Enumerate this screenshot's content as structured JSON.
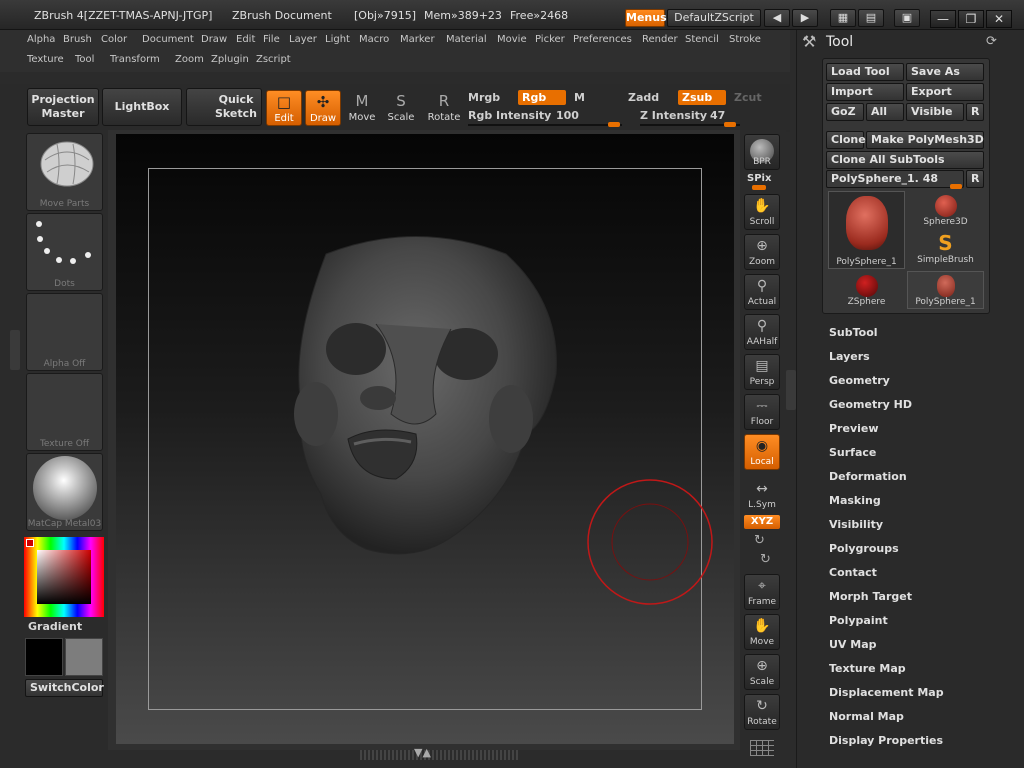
{
  "titlebar": {
    "app_title": "ZBrush 4[ZZET-TMAS-APNJ-JTGP]",
    "document": "ZBrush Document",
    "obj": "[Obj»7915]",
    "mem": "Mem»389+23",
    "free": "Free»2468",
    "menus_label": "Menus",
    "zscript_label": "DefaultZScript"
  },
  "menubar": {
    "row1": [
      "Alpha",
      "Brush",
      "Color",
      "Document",
      "Draw",
      "Edit",
      "File",
      "Layer",
      "Light",
      "Macro",
      "Marker",
      "Material",
      "Movie",
      "Picker",
      "Preferences",
      "Render",
      "Stencil",
      "Stroke"
    ],
    "row2": [
      "Texture",
      "Tool",
      "Transform",
      "Zoom",
      "Zplugin",
      "Zscript"
    ]
  },
  "shelf": {
    "projection_master": "Projection\nMaster",
    "lightbox": "LightBox",
    "quick_sketch": "Quick\nSketch",
    "edit": "Edit",
    "draw": "Draw",
    "move": "Move",
    "scale": "Scale",
    "rotate": "Rotate",
    "mrgb": "Mrgb",
    "rgb": "Rgb",
    "m": "M",
    "zadd": "Zadd",
    "zsub": "Zsub",
    "zcut": "Zcut",
    "rgb_intensity_label": "Rgb Intensity",
    "rgb_intensity": "100",
    "z_intensity_label": "Z Intensity",
    "z_intensity": "47"
  },
  "left": {
    "brush_caption": "Move Parts",
    "stroke_caption": "Dots",
    "alpha_caption": "Alpha Off",
    "texture_caption": "Texture Off",
    "material_caption": "MatCap Metal03",
    "gradient": "Gradient",
    "switchcolor": "SwitchColor"
  },
  "right": {
    "bpr": "BPR",
    "spix": "SPix",
    "scroll": "Scroll",
    "zoom": "Zoom",
    "actual": "Actual",
    "aahalf": "AAHalf",
    "persp": "Persp",
    "floor": "Floor",
    "local": "Local",
    "lsym": "L.Sym",
    "xyz": "XYZ",
    "frame": "Frame",
    "move": "Move",
    "scale": "Scale",
    "rotate": "Rotate"
  },
  "tool": {
    "title": "Tool",
    "load_tool": "Load Tool",
    "save_as": "Save As",
    "import": "Import",
    "export": "Export",
    "goz": "GoZ",
    "all": "All",
    "visible": "Visible",
    "r": "R",
    "clone": "Clone",
    "make_polymesh": "Make PolyMesh3D",
    "clone_all": "Clone All SubTools",
    "current_tool": "PolySphere_1. 48",
    "subtools": [
      "PolySphere_1",
      "Sphere3D",
      "SimpleBrush",
      "ZSphere",
      "PolySphere_1"
    ],
    "sections": [
      "SubTool",
      "Layers",
      "Geometry",
      "Geometry HD",
      "Preview",
      "Surface",
      "Deformation",
      "Masking",
      "Visibility",
      "Polygroups",
      "Contact",
      "Morph Target",
      "Polypaint",
      "UV Map",
      "Texture Map",
      "Displacement Map",
      "Normal Map",
      "Display Properties"
    ]
  },
  "colors": {
    "accent": "#e86f00",
    "panel": "#2b2b2b",
    "cursor_ring": "#c01818"
  }
}
